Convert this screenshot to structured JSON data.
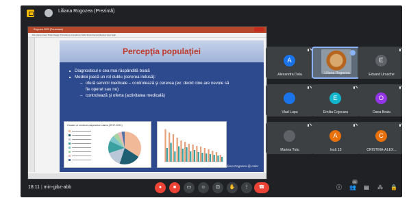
{
  "header": {
    "presenting_label": "Liliana Rogozea (Prezintă)"
  },
  "slide": {
    "window_title": "Rogozea 2022 (Prezentare)",
    "ribbon_tabs": "File  Home  Insert  Draw  Design  Transitions  Animations  Slide Show  Record  Review  View  Help",
    "title": "Percepţia populaţiei",
    "bullets": [
      "Diagnosticul e cea mai răspândită boală",
      "Medicii joacă un rol dublu (cererea indusă):"
    ],
    "sub_bullets": [
      "oferă servicii medicale – controlează şi cererea (ex: decid cine are nevoie să",
      "controlează şi oferta (activitatea medicală)"
    ],
    "sub_bullet_cont": "fie operat sau nu)",
    "pie_title": "Causes of medical malpractice claims (2017-2021)",
    "footer": "Profesor dr. Liliana Rogozea @ color"
  },
  "participants": [
    {
      "name": "Alexandra Dala",
      "initial": "A",
      "color": "#1a73e8"
    },
    {
      "name": "Liliana Rogozea",
      "initial": "",
      "color": "#8d9aa6"
    },
    {
      "name": "Eduard Ursache",
      "initial": "E",
      "color": "#5f6368"
    },
    {
      "name": "Vlad Lupu",
      "initial": "",
      "color": "#1a73e8"
    },
    {
      "name": "Emilia Cojocaru",
      "initial": "E",
      "color": "#12b5cb"
    },
    {
      "name": "Oana Bratu",
      "initial": "O",
      "color": "#9334e6"
    },
    {
      "name": "Marina Tutu",
      "initial": "",
      "color": "#5f6368"
    },
    {
      "name": "Încă 13",
      "initial": "A",
      "color": "#e8710a"
    },
    {
      "name": "CRISTINA-ALEX...",
      "initial": "C",
      "color": "#e8710a"
    }
  ],
  "controls": {
    "time": "18:11",
    "meeting_code": "min-gibz-abb",
    "participant_count": "21"
  },
  "chart_data": [
    {
      "type": "pie",
      "title": "Causes of medical malpractice claims (2017-2021)",
      "values": [
        34,
        21,
        15,
        12,
        6,
        5,
        4,
        3
      ],
      "colors": [
        "#f2b999",
        "#1f5f74",
        "#b9c7d9",
        "#3aa0a0",
        "#7dc4cb",
        "#a6d4a0",
        "#e6b8b7",
        "#4e6ea8"
      ]
    },
    {
      "type": "bar",
      "categories": [
        "1",
        "2",
        "3",
        "4",
        "5",
        "6",
        "7",
        "8",
        "9",
        "10",
        "11",
        "12",
        "13",
        "14",
        "15"
      ],
      "series": [
        {
          "values": [
            95,
            85,
            80,
            70,
            62,
            58,
            52,
            50,
            46,
            44,
            40,
            36,
            32,
            28,
            20
          ]
        },
        {
          "values": [
            40,
            55,
            30,
            45,
            38,
            42,
            30,
            34,
            28,
            26,
            24,
            22,
            20,
            18,
            14
          ]
        }
      ],
      "colors": [
        "#e6a07a",
        "#3aa0a0"
      ]
    }
  ]
}
